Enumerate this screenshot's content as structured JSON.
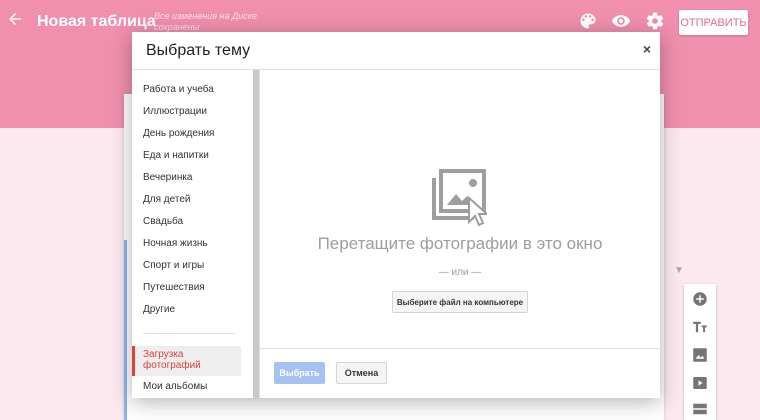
{
  "header": {
    "title": "Новая таблица",
    "save_status": "Все изменения на Диске сохранены",
    "send_label": "ОТПРАВИТЬ",
    "icons": [
      "back-arrow-icon",
      "palette-icon",
      "eye-icon",
      "gear-icon"
    ]
  },
  "dialog": {
    "title": "Выбрать тему",
    "close": "×",
    "nav_items": [
      "Работа и учеба",
      "Иллюстрации",
      "День рождения",
      "Еда и напитки",
      "Вечеринка",
      "Для детей",
      "Свадьба",
      "Ночная жизнь",
      "Спорт и игры",
      "Путешествия",
      "Другие"
    ],
    "active_item": "Загрузка фотографий",
    "albums_item": "Мои альбомы",
    "drop_text": "Перетащите фотографии в это окно",
    "or_text": "— или —",
    "choose_file": "Выберите файл на компьютере",
    "select_button": "Выбрать",
    "cancel_button": "Отмена"
  },
  "side_tools": [
    "add-icon",
    "text-icon",
    "image-icon",
    "video-icon",
    "section-icon"
  ],
  "colors": {
    "header": "#f08fae",
    "accent_red": "#db4437",
    "select_blue": "#a6c2f2"
  }
}
